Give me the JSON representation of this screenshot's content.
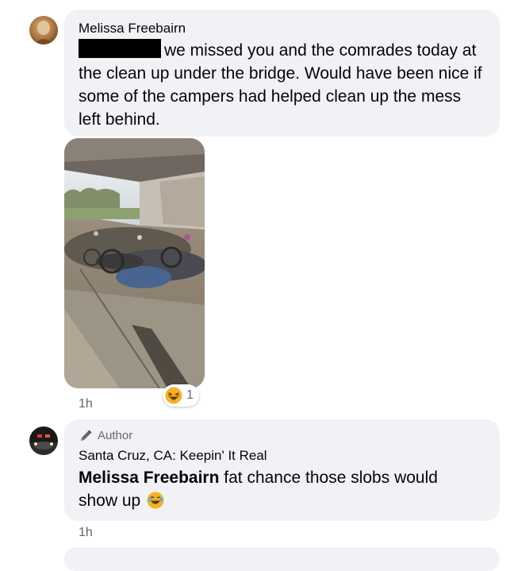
{
  "comment1": {
    "author": "Melissa Freebairn",
    "text_line1": "we missed you and the comrades today",
    "text_rest": "at the clean up under the bridge. Would have been nice if some of the campers had helped clean up the mess left behind.",
    "timestamp": "1h",
    "reaction_count": "1"
  },
  "comment2": {
    "badge": "Author",
    "author": "Santa Cruz, CA: Keepin' It Real",
    "mention": "Melissa Freebairn",
    "text": "fat chance those slobs would show up",
    "timestamp": "1h"
  },
  "colors": {
    "bubble": "#f0f2f5",
    "secondary_text": "#65676b",
    "text": "#050505"
  },
  "icons": {
    "reaction": "laughing-emoji-icon",
    "badge": "pencil-icon"
  }
}
